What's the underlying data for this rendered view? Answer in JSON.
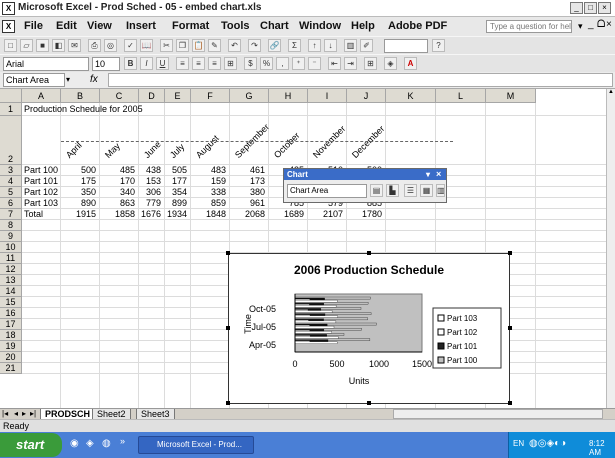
{
  "window": {
    "title": "Microsoft Excel - Prod Sched - 05 - embed chart.xls"
  },
  "menu": [
    "File",
    "Edit",
    "View",
    "Insert",
    "Format",
    "Tools",
    "Chart",
    "Window",
    "Help",
    "Adobe PDF"
  ],
  "help_placeholder": "Type a question for help",
  "formatting": {
    "font": "Arial",
    "size": "10"
  },
  "name_box": "Chart Area",
  "fx": "fx",
  "columns": [
    "A",
    "B",
    "C",
    "D",
    "E",
    "F",
    "G",
    "H",
    "I",
    "J",
    "K",
    "L",
    "M"
  ],
  "rows": [
    "1",
    "2",
    "3",
    "4",
    "5",
    "6",
    "7",
    "8",
    "9",
    "10",
    "11",
    "12",
    "13",
    "14",
    "15",
    "16",
    "17",
    "18",
    "19",
    "20",
    "21"
  ],
  "sheet": {
    "a1": "Production Schedule for 2005",
    "months": [
      "April",
      "May",
      "June",
      "July",
      "August",
      "September",
      "October",
      "November",
      "December"
    ],
    "data": [
      {
        "label": "Part 100",
        "values": [
          "500",
          "485",
          "438",
          "505",
          "483",
          "461",
          "435",
          "510",
          "500"
        ]
      },
      {
        "label": "Part 101",
        "values": [
          "175",
          "170",
          "153",
          "177",
          "159",
          "173",
          "174",
          "178",
          "175"
        ]
      },
      {
        "label": "Part 102",
        "values": [
          "350",
          "340",
          "306",
          "354",
          "338",
          "380",
          "341",
          "376",
          "390"
        ]
      },
      {
        "label": "Part 103",
        "values": [
          "890",
          "863",
          "779",
          "899",
          "859",
          "961",
          "785",
          "579",
          "885"
        ]
      },
      {
        "label": "Total",
        "values": [
          "1915",
          "1858",
          "1676",
          "1934",
          "1848",
          "2068",
          "1689",
          "2107",
          "1780"
        ]
      }
    ]
  },
  "chart_toolbar": {
    "title": "Chart",
    "selector": "Chart Area",
    "close": "×"
  },
  "chart_data": {
    "type": "bar",
    "title": "2006 Production Schedule",
    "xlabel": "Units",
    "ylabel": "Time",
    "xlim": [
      0,
      1500
    ],
    "xticks": [
      "0",
      "500",
      "1000",
      "1500"
    ],
    "yticks": [
      "Apr-05",
      "Jul-05",
      "Oct-05"
    ],
    "legend": [
      "Part 103",
      "Part 102",
      "Part 101",
      "Part 100"
    ],
    "legend_position": "right",
    "categories": [
      "April",
      "May",
      "June",
      "July",
      "August",
      "September",
      "October",
      "November",
      "December"
    ],
    "series": [
      {
        "name": "Part 100",
        "values": [
          500,
          485,
          438,
          505,
          483,
          461,
          435,
          510,
          500
        ]
      },
      {
        "name": "Part 101",
        "values": [
          175,
          170,
          153,
          177,
          159,
          173,
          174,
          178,
          175
        ]
      },
      {
        "name": "Part 102",
        "values": [
          350,
          340,
          306,
          354,
          338,
          380,
          341,
          376,
          390
        ]
      },
      {
        "name": "Part 103",
        "values": [
          890,
          863,
          779,
          899,
          859,
          961,
          785,
          579,
          885
        ]
      }
    ]
  },
  "sheet_tabs": [
    "PRODSCH",
    "Sheet2",
    "Sheet3"
  ],
  "status": "Ready",
  "taskbar": {
    "start": "start",
    "task": "Microsoft Excel - Prod...",
    "time": "8:12 AM"
  }
}
